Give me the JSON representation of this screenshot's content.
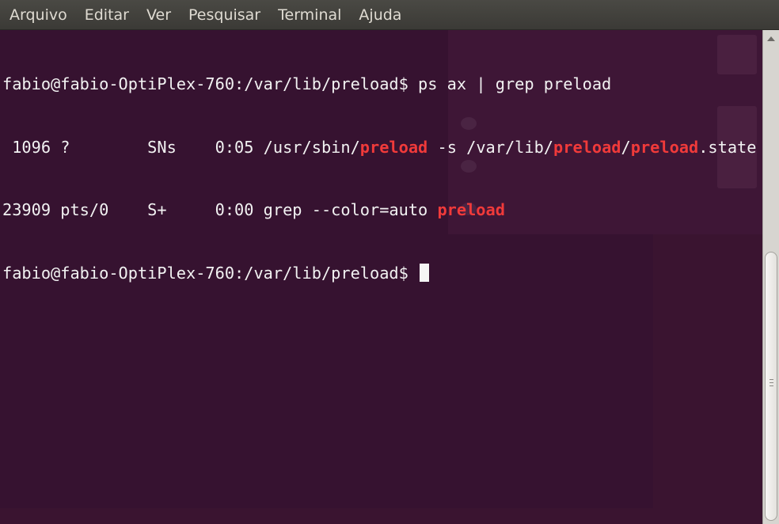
{
  "menu": {
    "items": [
      "Arquivo",
      "Editar",
      "Ver",
      "Pesquisar",
      "Terminal",
      "Ajuda"
    ]
  },
  "terminal": {
    "line1": {
      "prompt": "fabio@fabio-OptiPlex-760:/var/lib/preload$",
      "command": " ps ax | grep preload"
    },
    "line2": {
      "p1": " 1096 ?        SNs    0:05 /usr/sbin/",
      "h1": "preload",
      "p2": " -s /var/lib/",
      "h2": "preload",
      "p3": "/",
      "h3": "preload",
      "p4": ".state"
    },
    "line3": {
      "p1": "23909 pts/0    S+     0:00 grep --color=auto ",
      "h1": "preload"
    },
    "line4": {
      "prompt": "fabio@fabio-OptiPlex-760:/var/lib/preload$",
      "command": " "
    }
  },
  "colors": {
    "background": "#3a1430",
    "highlight": "#f03a3a",
    "text": "#f2f2f2",
    "menubar": "#3b3a36"
  }
}
